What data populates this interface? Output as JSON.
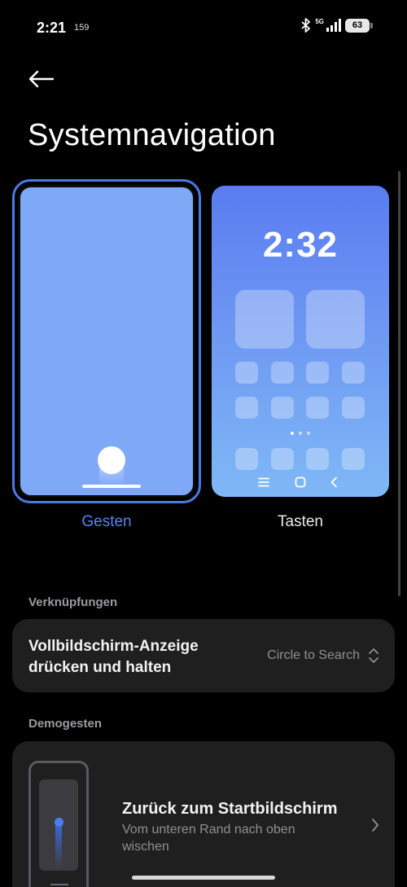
{
  "status_bar": {
    "time": "2:21",
    "extra": "159",
    "network_label": "5G",
    "battery": "63"
  },
  "page": {
    "title": "Systemnavigation"
  },
  "options": {
    "gesten": {
      "label": "Gesten",
      "selected": true
    },
    "tasten": {
      "label": "Tasten",
      "selected": false,
      "preview_clock": "2:32"
    }
  },
  "sections": {
    "shortcuts": {
      "header": "Verknüpfungen",
      "setting_title": "Vollbildschirm-Anzeige drücken und halten",
      "setting_value": "Circle to Search"
    },
    "demo": {
      "header": "Demogesten",
      "title": "Zurück zum Startbildschirm",
      "description": "Vom unteren Rand nach oben wischen"
    }
  },
  "colors": {
    "accent": "#4c78e6",
    "background": "#000000",
    "card": "#1f1f1f",
    "secondary_text": "#8f8f94"
  }
}
